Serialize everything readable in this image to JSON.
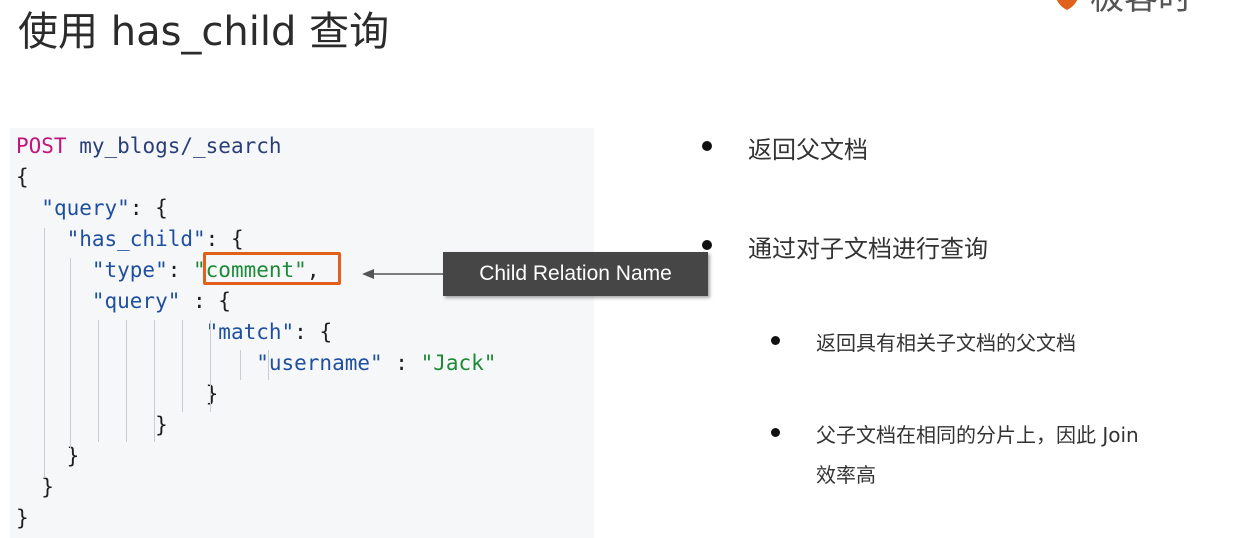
{
  "slide": {
    "title": "使用 has_child 查询",
    "logo_text": "极客时"
  },
  "code": {
    "lines": [
      {
        "tokens": [
          {
            "t": "POST",
            "c": "kw-post"
          },
          {
            "t": " ",
            "c": "tok-punc"
          },
          {
            "t": "my_blogs/_search",
            "c": "kw-path"
          }
        ]
      },
      {
        "tokens": [
          {
            "t": "{",
            "c": "tok-punc"
          }
        ]
      },
      {
        "tokens": [
          {
            "t": "  ",
            "c": "tok-punc"
          },
          {
            "t": "\"query\"",
            "c": "tok-key"
          },
          {
            "t": ": {",
            "c": "tok-punc"
          }
        ]
      },
      {
        "tokens": [
          {
            "t": "    ",
            "c": "tok-punc"
          },
          {
            "t": "\"has_child\"",
            "c": "tok-key"
          },
          {
            "t": ": {",
            "c": "tok-punc"
          }
        ]
      },
      {
        "tokens": [
          {
            "t": "      ",
            "c": "tok-punc"
          },
          {
            "t": "\"type\"",
            "c": "tok-key"
          },
          {
            "t": ": ",
            "c": "tok-punc"
          },
          {
            "t": "\"comment\"",
            "c": "tok-str"
          },
          {
            "t": ",",
            "c": "tok-punc"
          }
        ]
      },
      {
        "tokens": [
          {
            "t": "      ",
            "c": "tok-punc"
          },
          {
            "t": "\"query\"",
            "c": "tok-key"
          },
          {
            "t": " : {",
            "c": "tok-punc"
          }
        ]
      },
      {
        "tokens": [
          {
            "t": "               ",
            "c": "tok-punc"
          },
          {
            "t": "\"match\"",
            "c": "tok-key"
          },
          {
            "t": ": {",
            "c": "tok-punc"
          }
        ]
      },
      {
        "tokens": [
          {
            "t": "                   ",
            "c": "tok-punc"
          },
          {
            "t": "\"username\"",
            "c": "tok-key"
          },
          {
            "t": " : ",
            "c": "tok-punc"
          },
          {
            "t": "\"Jack\"",
            "c": "tok-str"
          }
        ]
      },
      {
        "tokens": [
          {
            "t": "               ",
            "c": "tok-punc"
          },
          {
            "t": "}",
            "c": "tok-punc"
          }
        ]
      },
      {
        "tokens": [
          {
            "t": "           ",
            "c": "tok-punc"
          },
          {
            "t": "}",
            "c": "tok-punc"
          }
        ]
      },
      {
        "tokens": [
          {
            "t": "    ",
            "c": "tok-punc"
          },
          {
            "t": "}",
            "c": "tok-punc"
          }
        ]
      },
      {
        "tokens": [
          {
            "t": "  ",
            "c": "tok-punc"
          },
          {
            "t": "}",
            "c": "tok-punc"
          }
        ]
      },
      {
        "tokens": [
          {
            "t": "}",
            "c": "tok-punc"
          }
        ]
      }
    ]
  },
  "callout": {
    "label": "Child Relation Name"
  },
  "bullets": {
    "level1": [
      "返回父文档",
      "通过对子文档进行查询"
    ],
    "level2": [
      "返回具有相关子文档的父文档",
      "父子文档在相同的分片上，因此 Join",
      "效率高"
    ]
  },
  "colors": {
    "highlight": "#e0601c",
    "callout_bg": "#464646",
    "post_keyword": "#c0157b",
    "json_key": "#1f4fa0",
    "json_string": "#1c8a36"
  }
}
